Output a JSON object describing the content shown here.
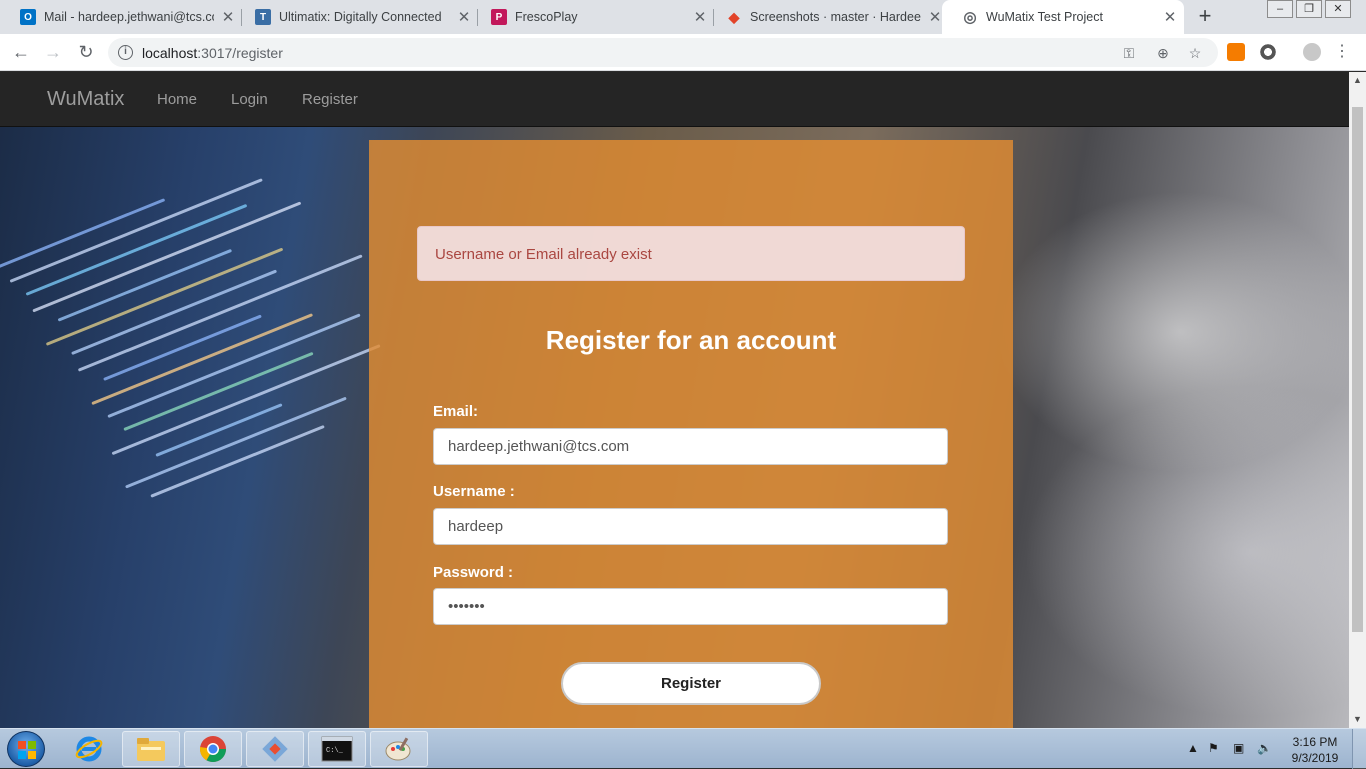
{
  "browser": {
    "tabs": [
      {
        "title": "Mail - hardeep.jethwani@tcs.cor",
        "icon": "outlook-icon",
        "color": "#0072c6",
        "glyph": "O"
      },
      {
        "title": "Ultimatix: Digitally Connected",
        "icon": "tata-icon",
        "color": "#3a6ea5",
        "glyph": "T"
      },
      {
        "title": "FrescoPlay",
        "icon": "frescoplay-icon",
        "color": "#c2185b",
        "glyph": "P"
      },
      {
        "title": "Screenshots · master · Hardeep J",
        "icon": "gitlab-icon",
        "color": "#e24329",
        "glyph": "◆"
      },
      {
        "title": "WuMatix Test Project",
        "icon": "globe-icon",
        "color": "#5f6368",
        "glyph": "◎"
      }
    ],
    "active_tab": 4,
    "new_tab": "+",
    "url_host": "localhost",
    "url_path": ":3017/register"
  },
  "app": {
    "brand": "WuMatix",
    "nav": [
      "Home",
      "Login",
      "Register"
    ],
    "alert": "Username or Email already exist",
    "heading": "Register for an account",
    "form": {
      "email_label": "Email:",
      "email_value": "hardeep.jethwani@tcs.com",
      "username_label": "Username :",
      "username_value": "hardeep",
      "password_label": "Password :",
      "password_value": "•••••••",
      "submit": "Register"
    }
  },
  "taskbar": {
    "time": "3:16 PM",
    "date": "9/3/2019",
    "apps": [
      "internet-explorer-icon",
      "file-explorer-icon",
      "chrome-icon",
      "git-icon",
      "command-prompt-icon",
      "paint-icon"
    ]
  },
  "colors": {
    "panel": "#e28c32",
    "alert_bg": "#f2dede",
    "alert_text": "#a94442",
    "navbar": "#252525"
  }
}
